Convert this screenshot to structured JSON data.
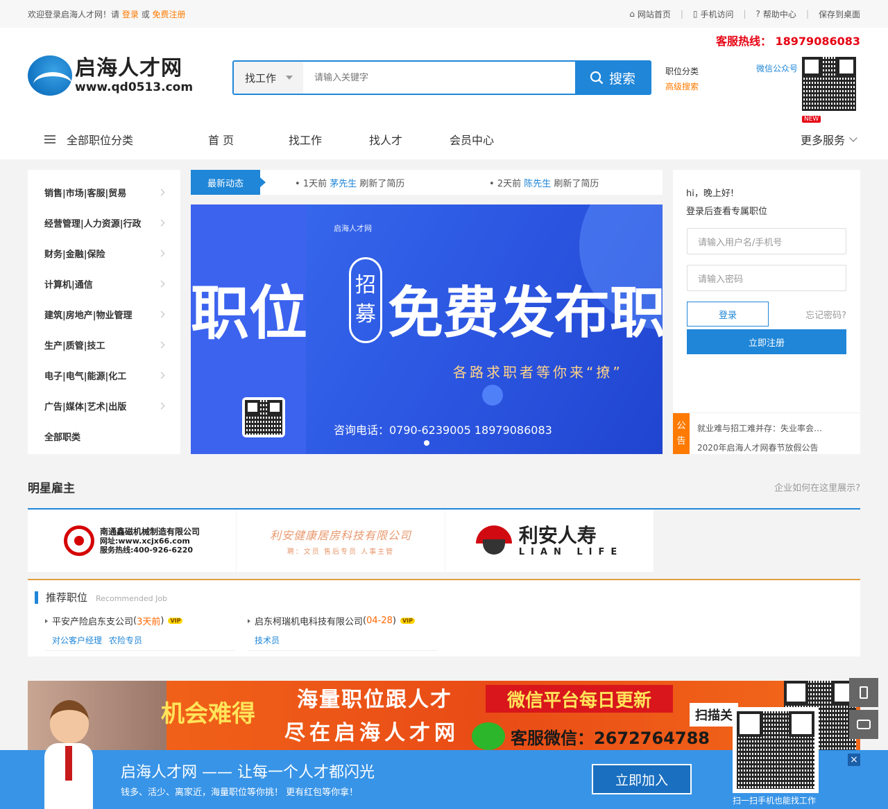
{
  "topbar": {
    "welcome": "欢迎登录启海人才网！请",
    "login": "登录",
    "or": "或",
    "register": "免费注册",
    "links": [
      "网站首页",
      "手机访问",
      "帮助中心",
      "保存到桌面"
    ]
  },
  "header": {
    "hotline": "客服热线： 18979086083",
    "logo_cn": "启海人才网",
    "logo_en": "www.qd0513.com",
    "search_type": "找工作",
    "search_placeholder": "请输入关键字",
    "search_button": "搜索",
    "link_category": "职位分类",
    "link_advanced": "高级搜索",
    "wechat": "微信公众号"
  },
  "nav": {
    "all": "全部职位分类",
    "items": [
      "首 页",
      "找工作",
      "找人才",
      "会员中心"
    ],
    "more": "更多服务",
    "new_badge": "NEW"
  },
  "categories": [
    "销售|市场|客服|贸易",
    "经营管理|人力资源|行政",
    "财务|金融|保险",
    "计算机|通信",
    "建筑|房地产|物业管理",
    "生产|质管|技工",
    "电子|电气|能源|化工",
    "广告|媒体|艺术|出版",
    "全部职类"
  ],
  "news": {
    "tag": "最新动态",
    "items": [
      {
        "time": "1天前",
        "name": "茅先生",
        "action": "刷新了简历"
      },
      {
        "time": "2天前",
        "name": "陈先生",
        "action": "刷新了简历"
      }
    ]
  },
  "banner": {
    "brand": "启海人才网",
    "left_text": "职位",
    "pill": [
      "招",
      "募"
    ],
    "headline": "免费发布职",
    "sub": "各路求职者等你来“撩”",
    "phone": "咨询电话：0790-6239005 18979086083"
  },
  "login": {
    "greet": "hi，晚上好!",
    "greet2": "登录后查看专属职位",
    "user_placeholder": "请输入用户名/手机号",
    "pwd_placeholder": "请输入密码",
    "login_btn": "登录",
    "forget": "忘记密码?",
    "register_btn": "立即注册",
    "notice_tag": [
      "公",
      "告"
    ],
    "notices": [
      "就业难与招工难并存：失业率会…",
      "2020年启海人才网春节放假公告"
    ]
  },
  "stars": {
    "title": "明星雇主",
    "right": "企业如何在这里展示?",
    "e1_l1": "南通鑫磁机械制造有限公司",
    "e1_l2": "网址:www.xcjx66.com",
    "e1_l3": "服务热线:400-926-6220",
    "e2_l1": "利安健康居房科技有限公司",
    "e2_l2": "聘：文员  售后专员  人事主管",
    "e3_l1": "利安人寿",
    "e3_l2": "LIAN LIFE"
  },
  "recommend": {
    "title": "推荐职位",
    "en": "Recommended Job",
    "jobs": [
      {
        "company": "平安产险启东支公司",
        "when": "3天前",
        "vip": "VIP",
        "positions": [
          "对公客户经理",
          "农险专员"
        ]
      },
      {
        "company": "启东柯瑞机电科技有限公司",
        "when": "04-28",
        "vip": "VIP",
        "positions": [
          "技术员"
        ]
      }
    ]
  },
  "ad": {
    "a": "机会难得",
    "b": "海量职位跟人才",
    "c": "尽在启海人才网",
    "d": "微信平台每日更新",
    "e": "客服微信：2672764788",
    "f": "扫描关"
  },
  "footbar": {
    "title": "启海人才网 —— 让每一个人才都闪光",
    "desc": "钱多、活少、离家近，海量职位等你挑！ 更有红包等你拿！",
    "join": "立即加入",
    "scan": "扫一扫手机也能找工作",
    "close": "×"
  }
}
